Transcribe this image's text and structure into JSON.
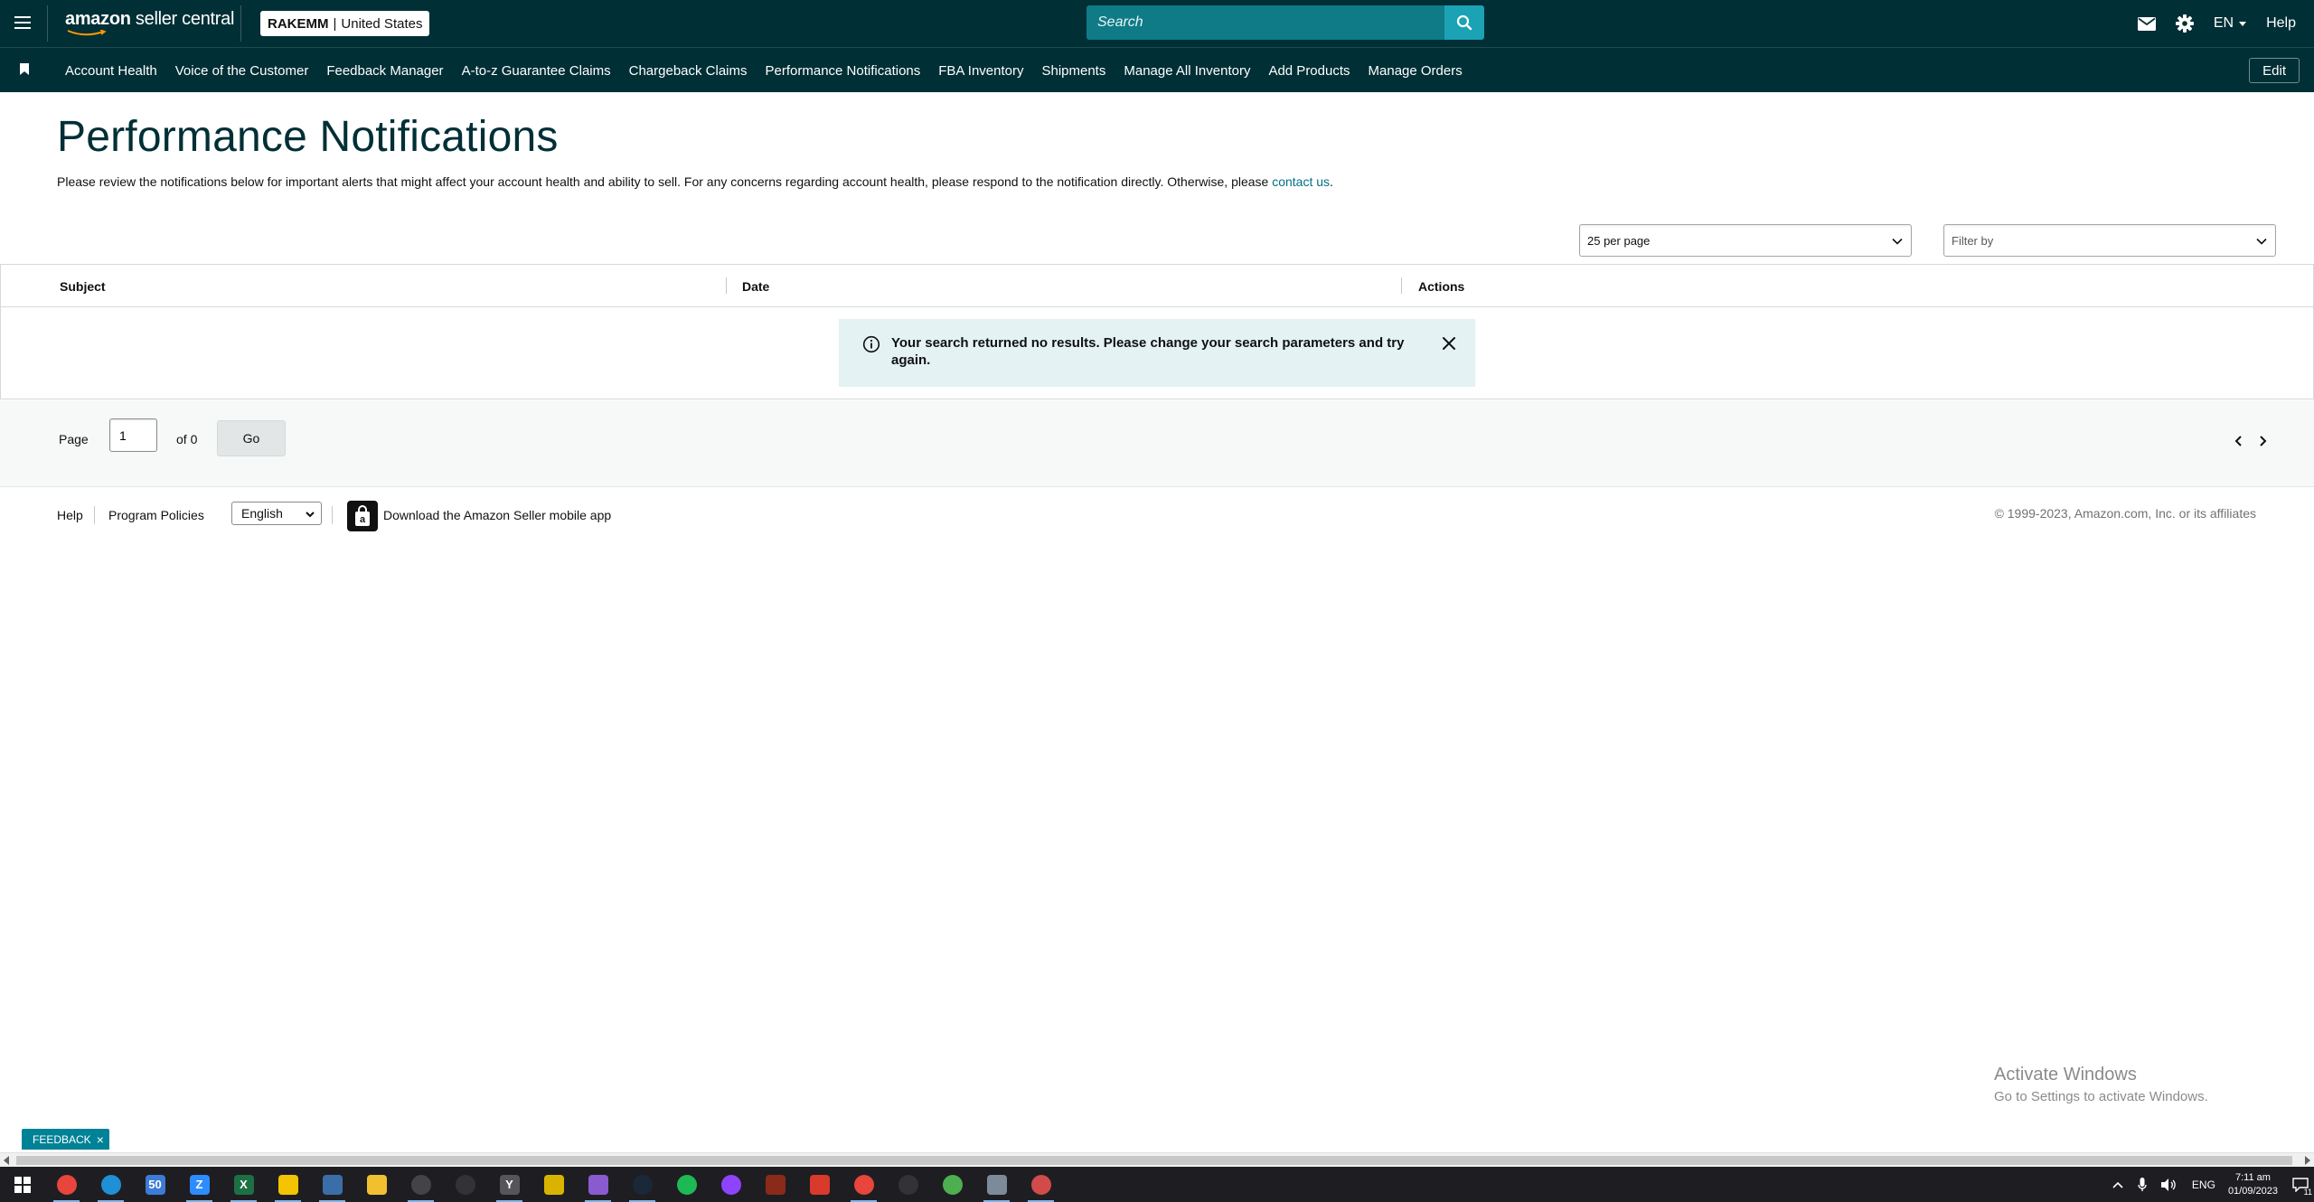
{
  "header": {
    "logo_text_a": "amazon",
    "logo_text_b": " seller central",
    "store_name": "RAKEMM",
    "store_sep": "|",
    "store_region": "United States",
    "search_placeholder": "Search",
    "lang_label": "EN",
    "help_label": "Help"
  },
  "nav": {
    "items": [
      "Account Health",
      "Voice of the Customer",
      "Feedback Manager",
      "A-to-z Guarantee Claims",
      "Chargeback Claims",
      "Performance Notifications",
      "FBA Inventory",
      "Shipments",
      "Manage All Inventory",
      "Add Products",
      "Manage Orders"
    ],
    "edit_label": "Edit"
  },
  "page": {
    "title": "Performance Notifications",
    "description": "Please review the notifications below for important alerts that might affect your account health and ability to sell. For any concerns regarding account health, please respond to the notification directly. Otherwise, please ",
    "contact_link": "contact us",
    "description_end": "."
  },
  "controls": {
    "per_page_value": "25 per page",
    "filter_placeholder": "Filter by"
  },
  "table": {
    "columns": [
      "Subject",
      "Date",
      "Actions"
    ],
    "rows": [],
    "empty_message": "Your search returned no results. Please change your search parameters and try again."
  },
  "pagination": {
    "page_label": "Page",
    "page_value": "1",
    "of_label": "of 0",
    "go_label": "Go"
  },
  "footer": {
    "help": "Help",
    "program_policies": "Program Policies",
    "language_selected": "English",
    "download_app": "Download the Amazon Seller mobile app",
    "copyright": "© 1999-2023, Amazon.com, Inc. or its affiliates"
  },
  "watermark": {
    "line1": "Activate Windows",
    "line2": "Go to Settings to activate Windows."
  },
  "feedback": {
    "label": "FEEDBACK",
    "close": "×"
  },
  "taskbar": {
    "apps": [
      {
        "name": "chrome",
        "color": "#e8453c",
        "glyph": ""
      },
      {
        "name": "edge",
        "color": "#1f8fd6",
        "glyph": ""
      },
      {
        "name": "mail-badge",
        "color": "#3d7bd6",
        "glyph": "50"
      },
      {
        "name": "zoom",
        "color": "#2d8cff",
        "glyph": "Z"
      },
      {
        "name": "excel",
        "color": "#1d7044",
        "glyph": "X"
      },
      {
        "name": "sticky-notes",
        "color": "#f4c400",
        "glyph": ""
      },
      {
        "name": "calculator",
        "color": "#3b6ea8",
        "glyph": ""
      },
      {
        "name": "file-explorer",
        "color": "#f0c030",
        "glyph": ""
      },
      {
        "name": "clock-app",
        "color": "#444448",
        "glyph": ""
      },
      {
        "name": "steelseries",
        "color": "#333336",
        "glyph": ""
      },
      {
        "name": "app-y",
        "color": "#55555a",
        "glyph": "Y"
      },
      {
        "name": "app-square",
        "color": "#d9b300",
        "glyph": ""
      },
      {
        "name": "chat-badge",
        "color": "#8a5ad0",
        "glyph": ""
      },
      {
        "name": "steam",
        "color": "#1b2838",
        "glyph": ""
      },
      {
        "name": "spotify",
        "color": "#1db954",
        "glyph": ""
      },
      {
        "name": "messenger",
        "color": "#8e44ff",
        "glyph": ""
      },
      {
        "name": "game-app",
        "color": "#8a2b1a",
        "glyph": ""
      },
      {
        "name": "red-app",
        "color": "#d93a2b",
        "glyph": ""
      },
      {
        "name": "chrome-active",
        "color": "#e8453c",
        "glyph": ""
      },
      {
        "name": "steelseries-2",
        "color": "#333336",
        "glyph": ""
      },
      {
        "name": "chrome-2",
        "color": "#4caf50",
        "glyph": ""
      },
      {
        "name": "image-app",
        "color": "#7d8a99",
        "glyph": ""
      },
      {
        "name": "chrome-3",
        "color": "#d24b4b",
        "glyph": ""
      }
    ],
    "lang": "ENG",
    "time": "7:11 am",
    "date": "01/09/2023",
    "notif_count": "11"
  },
  "colors": {
    "header_bg": "#002f36",
    "search_bg": "#0f7b86",
    "search_btn": "#1ba2b4",
    "link": "#007185",
    "alert_bg": "#e4f2f3"
  }
}
